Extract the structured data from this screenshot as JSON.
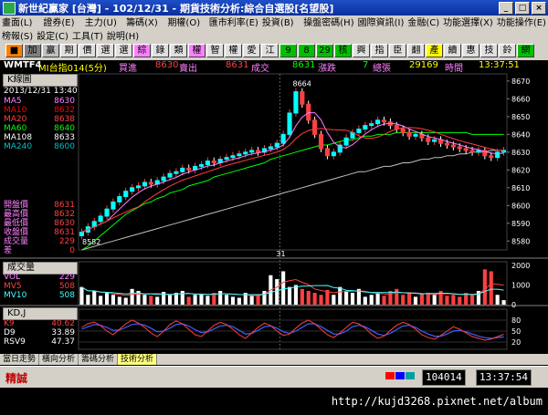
{
  "window": {
    "title": "新世紀贏家 [台灣] - 102/12/31 - 期貨技術分析:綜合自選股[名望股]",
    "controls": [
      "_",
      "□",
      "×"
    ]
  },
  "menu": {
    "row1": [
      "畫面(L)",
      "證券(E)",
      "主力(U)",
      "籌碼(X)",
      "期權(O)",
      "匯市利率(E)",
      "投資(B)",
      "操盤密碼(H)",
      "國際資訊(I)",
      "金融(C)",
      "功能選擇(X)",
      "功能操作(E)"
    ],
    "row2": [
      "榜報(S)",
      "設定(C)",
      "工具(T)",
      "說明(H)"
    ]
  },
  "toolbar": {
    "buttons": [
      {
        "label": "■",
        "bg": "#ff8000"
      },
      {
        "label": "加",
        "bg": "#808080"
      },
      {
        "label": "贏",
        "bg": "#c0c0c0"
      },
      {
        "label": "期",
        "bg": "#e0e0e0"
      },
      {
        "label": "價",
        "bg": "#e0e0e0"
      },
      {
        "label": "選",
        "bg": "#e0e0e0"
      },
      {
        "label": "選",
        "bg": "#e0e0e0"
      },
      {
        "label": "綜",
        "bg": "#ff80ff"
      },
      {
        "label": "錄",
        "bg": "#e0e0e0"
      },
      {
        "label": "類",
        "bg": "#e0e0e0"
      },
      {
        "label": "權",
        "bg": "#ff80ff"
      },
      {
        "label": "智",
        "bg": "#e0e0e0"
      },
      {
        "label": "權",
        "bg": "#e0e0e0"
      },
      {
        "label": "愛",
        "bg": "#e0e0e0"
      },
      {
        "label": "江",
        "bg": "#e0e0e0"
      },
      {
        "label": "9",
        "bg": "#00c000"
      },
      {
        "label": "8",
        "bg": "#00c000"
      },
      {
        "label": "29",
        "bg": "#00c000"
      },
      {
        "label": "核",
        "bg": "#00c000"
      },
      {
        "label": "興",
        "bg": "#e0e0e0"
      },
      {
        "label": "指",
        "bg": "#e0e0e0"
      },
      {
        "label": "臣",
        "bg": "#e0e0e0"
      },
      {
        "label": "翻",
        "bg": "#e0e0e0"
      },
      {
        "label": "產",
        "bg": "#ffff00"
      },
      {
        "label": "續",
        "bg": "#e0e0e0"
      },
      {
        "label": "惠",
        "bg": "#e0e0e0"
      },
      {
        "label": "技",
        "bg": "#e0e0e0"
      },
      {
        "label": "鈴",
        "bg": "#e0e0e0"
      },
      {
        "label": "網",
        "bg": "#00c000"
      }
    ]
  },
  "quote": {
    "symbol": "WMTF4",
    "name": "MI台指014(5分)",
    "bid_label": "買進",
    "bid": "8630",
    "ask_label": "賣出",
    "ask": "8631",
    "last_label": "成交",
    "last": "8631",
    "change_label": "漲跌",
    "change": "7",
    "volume_label": "總張",
    "volume": "29169",
    "time_label": "時間",
    "time": "13:37:51"
  },
  "kline_panel": {
    "title": "K線圖",
    "date": "2013/12/31  13:40",
    "ma_legend": [
      {
        "name": "MA5",
        "value": "8630",
        "color": "#ff80ff"
      },
      {
        "name": "MA10",
        "value": "8632",
        "color": "#ff0000"
      },
      {
        "name": "MA20",
        "value": "8638",
        "color": "#ff4040"
      },
      {
        "name": "MA60",
        "value": "8640",
        "color": "#00ff00"
      },
      {
        "name": "MA108",
        "value": "8633",
        "color": "#ffffff"
      },
      {
        "name": "MA240",
        "value": "8600",
        "color": "#00c0c0"
      }
    ],
    "stats": [
      {
        "name": "開盤價",
        "value": "8631"
      },
      {
        "name": "最高價",
        "value": "8632"
      },
      {
        "name": "最低價",
        "value": "8630"
      },
      {
        "name": "收盤價",
        "value": "8631"
      },
      {
        "name": "成交量",
        "value": "229"
      },
      {
        "name": "差",
        "value": "0"
      }
    ],
    "high_label": "8664",
    "low_label": "8582",
    "x_tick": "31",
    "y_ticks": [
      "8670",
      "8660",
      "8650",
      "8640",
      "8630",
      "8620",
      "8610",
      "8600",
      "8590",
      "8580"
    ]
  },
  "volume_panel": {
    "title": "成交量",
    "legend": [
      {
        "name": "VOL",
        "value": "229",
        "color": "#ff80ff"
      },
      {
        "name": "MV5",
        "value": "508",
        "color": "#ff4040"
      },
      {
        "name": "MV10",
        "value": "508",
        "color": "#40ffff"
      }
    ],
    "y_ticks": [
      "2000",
      "1000",
      "0"
    ]
  },
  "kd_panel": {
    "title": "KD,J",
    "legend": [
      {
        "name": "K9",
        "value": "40.62",
        "color": "#ff4040"
      },
      {
        "name": "D9",
        "value": "33.89",
        "color": "#ffffff"
      },
      {
        "name": "RSV9",
        "value": "47.37",
        "color": "#ffffff"
      }
    ],
    "y_ticks": [
      "80",
      "50",
      "20"
    ]
  },
  "tabs": [
    "當日走勢",
    "橫向分析",
    "籌碼分析",
    "技術分析"
  ],
  "status": {
    "brand": "精誠",
    "code": "104014",
    "clock": "13:37:54"
  },
  "footer": {
    "url": "http://kujd3268.pixnet.net/album"
  },
  "chart_data": {
    "type": "line",
    "title": "K線圖",
    "ylim": [
      8575,
      8672
    ],
    "candles": [
      8585,
      8588,
      8591,
      8594,
      8598,
      8602,
      8605,
      8608,
      8610,
      8611,
      8613,
      8612,
      8614,
      8616,
      8618,
      8619,
      8621,
      8620,
      8622,
      8623,
      8625,
      8624,
      8626,
      8627,
      8628,
      8629,
      8630,
      8631,
      8630,
      8632,
      8633,
      8635,
      8640,
      8652,
      8664,
      8657,
      8648,
      8640,
      8632,
      8628,
      8630,
      8634,
      8638,
      8641,
      8643,
      8645,
      8646,
      8648,
      8647,
      8645,
      8643,
      8641,
      8639,
      8640,
      8638,
      8636,
      8637,
      8635,
      8634,
      8633,
      8632,
      8631,
      8630,
      8631,
      8628,
      8627,
      8630,
      8631
    ],
    "ma60": [
      8575,
      8577,
      8580,
      8583,
      8586,
      8589,
      8592,
      8595,
      8597,
      8599,
      8601,
      8602,
      8604,
      8605,
      8607,
      8608,
      8609,
      8611,
      8612,
      8613,
      8614,
      8616,
      8617,
      8618,
      8619,
      8620,
      8621,
      8622,
      8623,
      8624,
      8626,
      8627,
      8628,
      8629,
      8630,
      8631,
      8632,
      8633,
      8634,
      8634,
      8635,
      8636,
      8637,
      8637,
      8638,
      8639,
      8639,
      8640,
      8640,
      8640,
      8641,
      8641,
      8641,
      8641,
      8641,
      8641,
      8641,
      8641,
      8641,
      8641,
      8641,
      8641,
      8640,
      8640,
      8640,
      8640,
      8640,
      8640
    ],
    "ma240": [
      8575,
      8576,
      8577,
      8578,
      8579,
      8580,
      8581,
      8582,
      8583,
      8584,
      8585,
      8586,
      8587,
      8588,
      8589,
      8590,
      8591,
      8592,
      8593,
      8594,
      8595,
      8596,
      8597,
      8598,
      8599,
      8600,
      8601,
      8602,
      8603,
      8604,
      8605,
      8606,
      8607,
      8608,
      8609,
      8610,
      8611,
      8612,
      8613,
      8614,
      8615,
      8616,
      8617,
      8618,
      8619,
      8619,
      8620,
      8621,
      8622,
      8622,
      8623,
      8624,
      8624,
      8625,
      8626,
      8626,
      8627,
      8627,
      8628,
      8628,
      8629,
      8629,
      8630,
      8630,
      8630,
      8631,
      8631,
      8631
    ],
    "volume": [
      900,
      500,
      700,
      450,
      600,
      500,
      400,
      350,
      800,
      700,
      500,
      450,
      400,
      650,
      500,
      600,
      700,
      400,
      500,
      550,
      450,
      600,
      700,
      500,
      400,
      350,
      600,
      450,
      500,
      700,
      1500,
      1300,
      1700,
      900,
      1000,
      800,
      700,
      600,
      500,
      750,
      500,
      900,
      700,
      600,
      800,
      400,
      500,
      600,
      450,
      700,
      800,
      500,
      600,
      400,
      550,
      600,
      500,
      700,
      450,
      500,
      400,
      600,
      500,
      700,
      1800,
      1700,
      500,
      229
    ],
    "kd_k": [
      60,
      70,
      75,
      65,
      50,
      40,
      55,
      70,
      80,
      72,
      60,
      45,
      35,
      50,
      68,
      78,
      70,
      55,
      40,
      35,
      50,
      66,
      74,
      68,
      55,
      40,
      30,
      45,
      60,
      72,
      65,
      50,
      38,
      42,
      58,
      72,
      80,
      70,
      55,
      40,
      32,
      45,
      60,
      74,
      70,
      58,
      42,
      30,
      36,
      52,
      66,
      74,
      68,
      55,
      40,
      32,
      28,
      38,
      50,
      62,
      55,
      45,
      35,
      30,
      25,
      28,
      35,
      41
    ],
    "kd_d": [
      55,
      62,
      68,
      66,
      60,
      52,
      53,
      60,
      68,
      70,
      66,
      58,
      48,
      50,
      58,
      68,
      70,
      64,
      54,
      46,
      48,
      56,
      64,
      66,
      62,
      52,
      42,
      44,
      52,
      62,
      64,
      58,
      48,
      44,
      50,
      60,
      70,
      70,
      62,
      52,
      42,
      42,
      50,
      62,
      66,
      62,
      52,
      42,
      38,
      44,
      54,
      64,
      66,
      60,
      50,
      42,
      36,
      36,
      42,
      50,
      52,
      48,
      42,
      36,
      32,
      30,
      32,
      34
    ]
  }
}
